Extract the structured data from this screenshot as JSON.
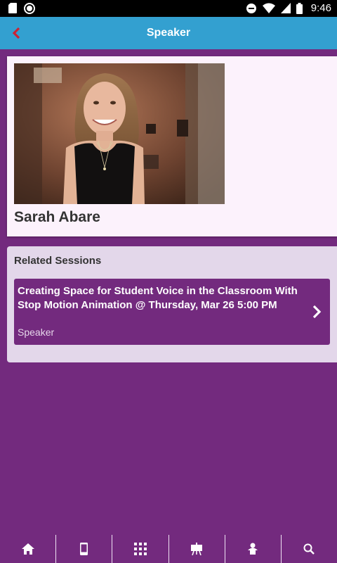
{
  "status_bar": {
    "time": "9:46"
  },
  "app_bar": {
    "title": "Speaker"
  },
  "speaker": {
    "name": "Sarah Abare"
  },
  "related": {
    "title": "Related Sessions",
    "sessions": [
      {
        "title": "Creating Space for Student Voice in the Classroom With Stop Motion Animation @ Thursday, Mar 26 5:00 PM",
        "role": "Speaker"
      }
    ]
  },
  "colors": {
    "primary": "#732a7e",
    "app_bar": "#33a0d0",
    "back_arrow": "#cc2233"
  },
  "bottom_nav": [
    "home-icon",
    "mobile-icon",
    "grid-icon",
    "presentation-icon",
    "speaker-icon",
    "search-icon"
  ]
}
